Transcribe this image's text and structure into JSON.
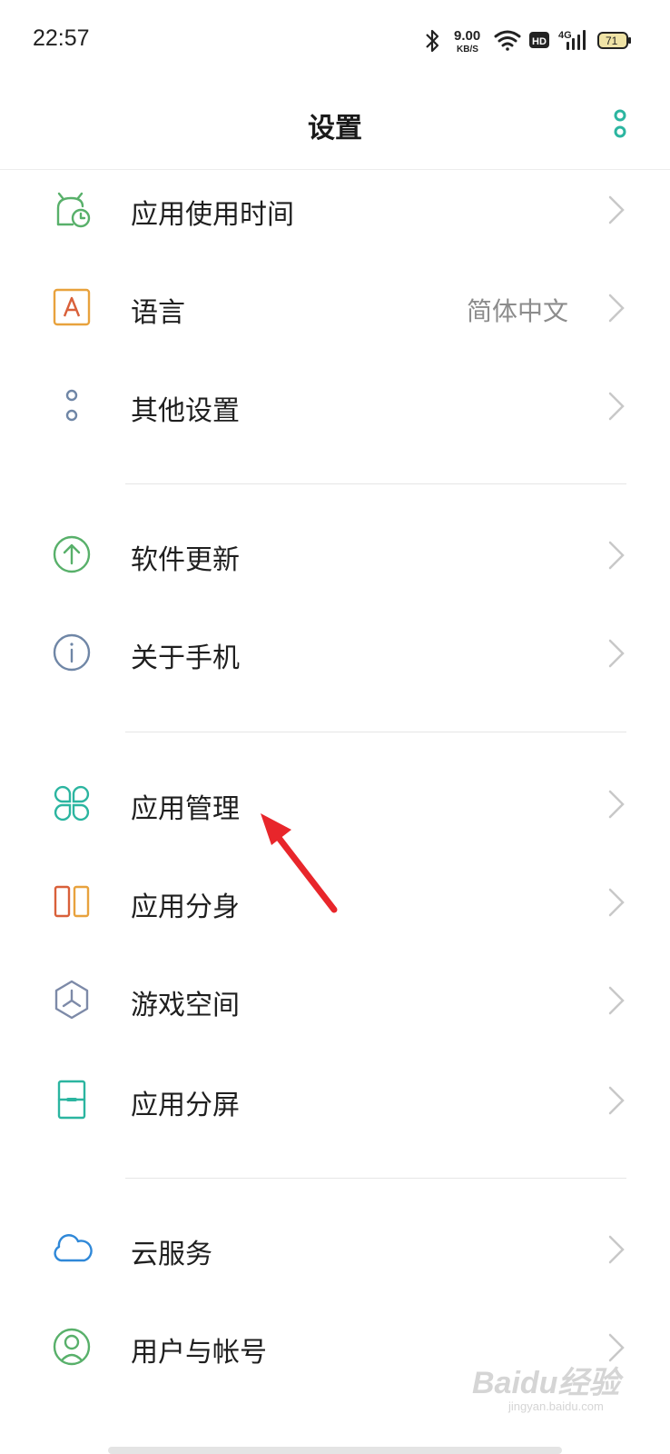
{
  "status_bar": {
    "time": "22:57",
    "net_speed_value": "9.00",
    "net_speed_unit": "KB/S",
    "hd_badge": "HD",
    "network_type": "4G",
    "battery_level": "71",
    "icons": [
      "bluetooth-icon",
      "wifi-icon",
      "hd-icon",
      "signal-icon",
      "battery-icon"
    ]
  },
  "header": {
    "title": "设置",
    "more_icon": "more-vertical-icon"
  },
  "settings": {
    "items": [
      {
        "label": "应用使用时间",
        "icon": "app-usage-time-icon",
        "color": "#58b06a"
      },
      {
        "label": "语言",
        "value": "简体中文",
        "icon": "language-icon",
        "color": "#e8a23d"
      },
      {
        "label": "其他设置",
        "icon": "other-settings-icon",
        "color": "#6f86a6"
      },
      {
        "label": "软件更新",
        "icon": "software-update-icon",
        "color": "#58b06a"
      },
      {
        "label": "关于手机",
        "icon": "about-phone-icon",
        "color": "#6f86a6"
      },
      {
        "label": "应用管理",
        "icon": "app-management-icon",
        "color": "#2bb5a0"
      },
      {
        "label": "应用分身",
        "icon": "app-clone-icon",
        "color": "#e07a3d"
      },
      {
        "label": "游戏空间",
        "icon": "game-space-icon",
        "color": "#7d8aa8"
      },
      {
        "label": "应用分屏",
        "icon": "split-screen-icon",
        "color": "#2bb5a0"
      },
      {
        "label": "云服务",
        "icon": "cloud-service-icon",
        "color": "#2f88d8"
      },
      {
        "label": "用户与帐号",
        "icon": "user-account-icon",
        "color": "#58b06a"
      }
    ]
  },
  "annotation": {
    "arrow_color": "#e8262b"
  },
  "watermark": {
    "brand": "Baidu经验",
    "site": "jingyan.baidu.com"
  }
}
